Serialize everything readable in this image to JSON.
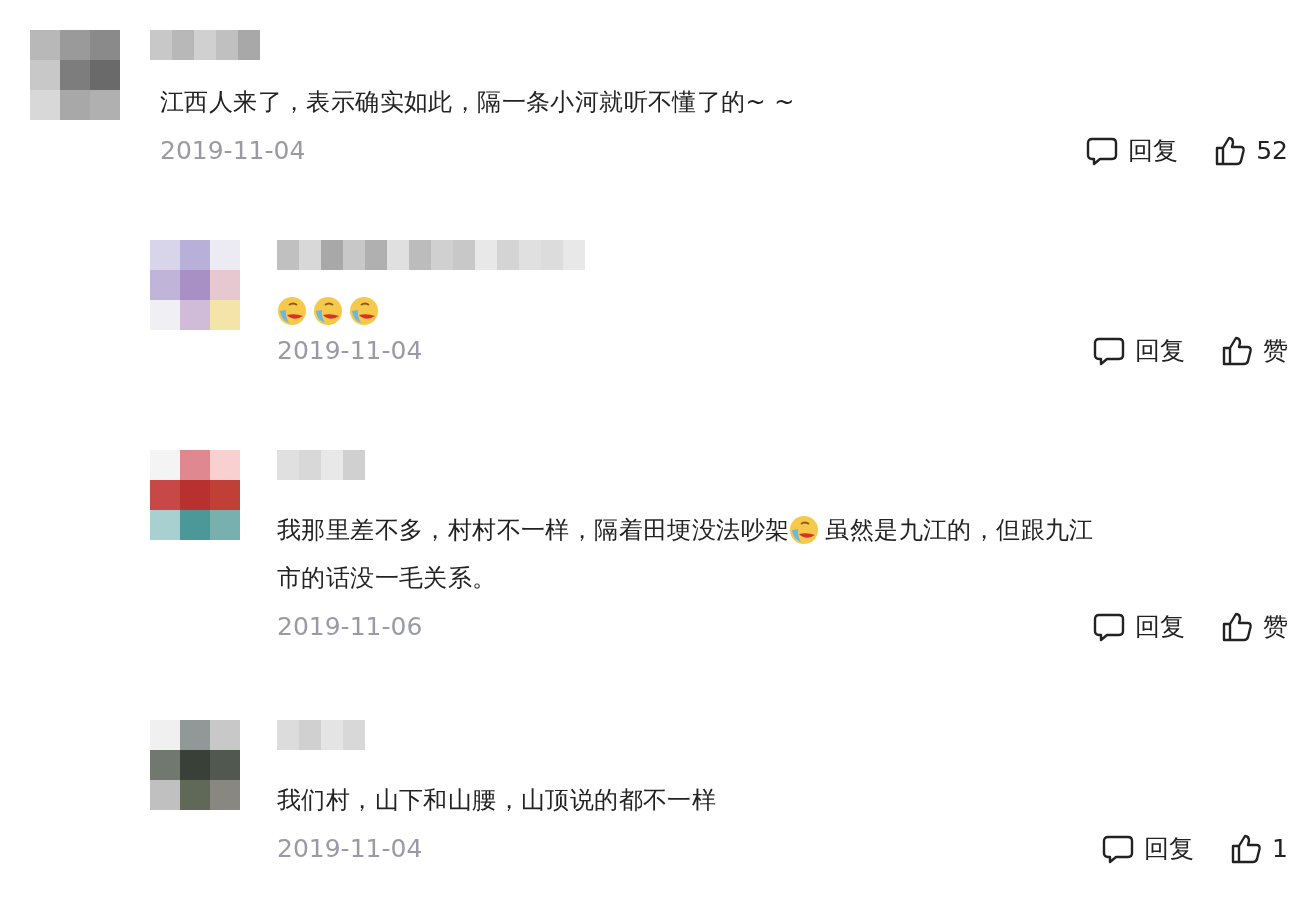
{
  "comments": [
    {
      "kind": "top",
      "content": [
        {
          "kind": "text",
          "text": "江西人来了，表示确实如此，隔一条小河就听不懂了的~ ~"
        }
      ],
      "date": "2019-11-04",
      "reply_label": "回复",
      "like_label": "52"
    },
    {
      "kind": "reply",
      "content": [
        {
          "kind": "emoji"
        },
        {
          "kind": "emoji"
        },
        {
          "kind": "emoji"
        }
      ],
      "date": "2019-11-04",
      "reply_label": "回复",
      "like_label": "赞"
    },
    {
      "kind": "reply",
      "content": [
        {
          "kind": "text",
          "text": "我那里差不多，村村不一样，隔着田埂没法吵架"
        },
        {
          "kind": "emoji"
        },
        {
          "kind": "text",
          "text": "虽然是九江的，但跟九江"
        },
        {
          "kind": "text",
          "text": "市的话没一毛关系。"
        }
      ],
      "date": "2019-11-06",
      "reply_label": "回复",
      "like_label": "赞"
    },
    {
      "kind": "reply",
      "content": [
        {
          "kind": "text",
          "text": "我们村，山下和山腰，山顶说的都不一样"
        }
      ],
      "date": "2019-11-04",
      "reply_label": "回复",
      "like_label": "1"
    }
  ]
}
